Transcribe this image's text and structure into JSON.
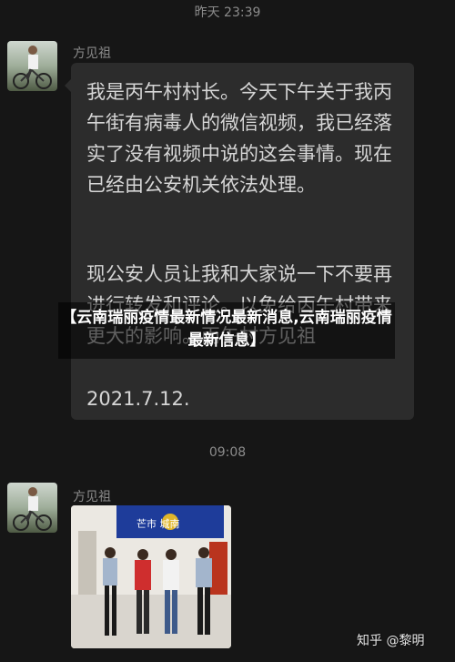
{
  "chat": {
    "timestamps": [
      "昨天 23:39",
      "09:08"
    ],
    "messages": [
      {
        "sender": "方见祖",
        "paragraphs": [
          "我是丙午村村长。今天下午关于我丙午街有病毒人的微信视频，我已经落实了没有视频中说的这会事情。现在已经由公安机关依法处理。",
          "现公安人员让我和大家说一下不要再进行转发和评论。以免给丙午村带来更大的影响。丙午村方见祖",
          "2021.7.12."
        ]
      },
      {
        "sender": "方见祖",
        "image": {
          "sign_text": "芒市 城南"
        }
      }
    ]
  },
  "overlay": {
    "headline": "【云南瑞丽疫情最新情况最新消息,云南瑞丽疫情最新信息】"
  },
  "watermark": {
    "text": "知乎 @黎明"
  },
  "colors": {
    "background": "#161616",
    "bubble": "#2c2c2c",
    "text": "#d6d6d6",
    "meta": "#8a8a8a"
  }
}
